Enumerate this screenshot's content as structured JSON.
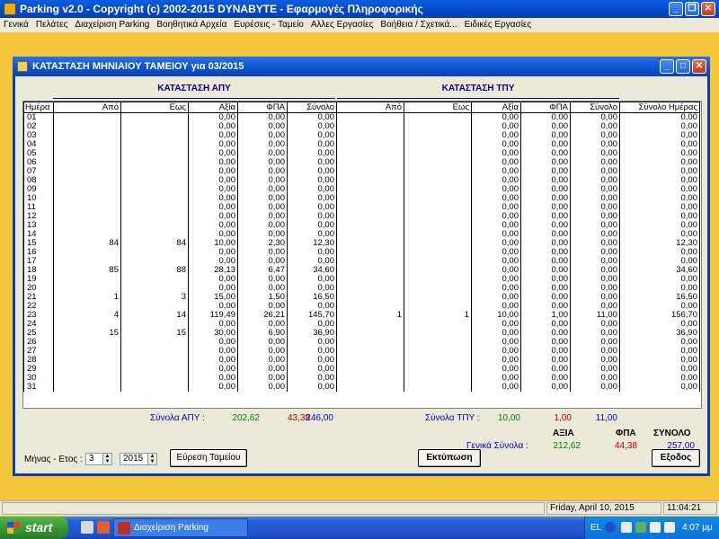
{
  "app": {
    "title": "Parking v2.0  -  Copyright (c) 2002-2015  DYNABYTE - Εφαρμογές Πληροφορικής"
  },
  "menu": [
    "Γενικά",
    "Πελάτες",
    "Διαχείριση Parking",
    "Βοηθητικά Αρχεία",
    "Ευρέσεις - Ταμείο",
    "Αλλες Εργασίες",
    "Βοήθεια / Σχετικά...",
    "Ειδικές Εργασίες"
  ],
  "dialog": {
    "title": "ΚΑΤΑΣΤΑΣΗ ΜΗΝΙΑΙΟΥ ΤΑΜΕΙΟΥ για  03/2015",
    "section_apy": "ΚΑΤΑΣΤΑΣΗ ΑΠΥ",
    "section_tpy": "ΚΑΤΑΣΤΑΣΗ ΤΠΥ",
    "columns": [
      "Ημέρα",
      "Από",
      "Εως",
      "Αξία",
      "ΦΠΑ",
      "Σύνολο",
      "Από",
      "Εως",
      "Αξία",
      "ΦΠΑ",
      "Σύνολο",
      "Σύνολο Ημέρας"
    ],
    "rows": [
      [
        "01",
        "",
        "",
        "0,00",
        "0,00",
        "0,00",
        "",
        "",
        "0,00",
        "0,00",
        "0,00",
        "0,00"
      ],
      [
        "02",
        "",
        "",
        "0,00",
        "0,00",
        "0,00",
        "",
        "",
        "0,00",
        "0,00",
        "0,00",
        "0,00"
      ],
      [
        "03",
        "",
        "",
        "0,00",
        "0,00",
        "0,00",
        "",
        "",
        "0,00",
        "0,00",
        "0,00",
        "0,00"
      ],
      [
        "04",
        "",
        "",
        "0,00",
        "0,00",
        "0,00",
        "",
        "",
        "0,00",
        "0,00",
        "0,00",
        "0,00"
      ],
      [
        "05",
        "",
        "",
        "0,00",
        "0,00",
        "0,00",
        "",
        "",
        "0,00",
        "0,00",
        "0,00",
        "0,00"
      ],
      [
        "06",
        "",
        "",
        "0,00",
        "0,00",
        "0,00",
        "",
        "",
        "0,00",
        "0,00",
        "0,00",
        "0,00"
      ],
      [
        "07",
        "",
        "",
        "0,00",
        "0,00",
        "0,00",
        "",
        "",
        "0,00",
        "0,00",
        "0,00",
        "0,00"
      ],
      [
        "08",
        "",
        "",
        "0,00",
        "0,00",
        "0,00",
        "",
        "",
        "0,00",
        "0,00",
        "0,00",
        "0,00"
      ],
      [
        "09",
        "",
        "",
        "0,00",
        "0,00",
        "0,00",
        "",
        "",
        "0,00",
        "0,00",
        "0,00",
        "0,00"
      ],
      [
        "10",
        "",
        "",
        "0,00",
        "0,00",
        "0,00",
        "",
        "",
        "0,00",
        "0,00",
        "0,00",
        "0,00"
      ],
      [
        "11",
        "",
        "",
        "0,00",
        "0,00",
        "0,00",
        "",
        "",
        "0,00",
        "0,00",
        "0,00",
        "0,00"
      ],
      [
        "12",
        "",
        "",
        "0,00",
        "0,00",
        "0,00",
        "",
        "",
        "0,00",
        "0,00",
        "0,00",
        "0,00"
      ],
      [
        "13",
        "",
        "",
        "0,00",
        "0,00",
        "0,00",
        "",
        "",
        "0,00",
        "0,00",
        "0,00",
        "0,00"
      ],
      [
        "14",
        "",
        "",
        "0,00",
        "0,00",
        "0,00",
        "",
        "",
        "0,00",
        "0,00",
        "0,00",
        "0,00"
      ],
      [
        "15",
        "84",
        "84",
        "10,00",
        "2,30",
        "12,30",
        "",
        "",
        "0,00",
        "0,00",
        "0,00",
        "12,30"
      ],
      [
        "16",
        "",
        "",
        "0,00",
        "0,00",
        "0,00",
        "",
        "",
        "0,00",
        "0,00",
        "0,00",
        "0,00"
      ],
      [
        "17",
        "",
        "",
        "0,00",
        "0,00",
        "0,00",
        "",
        "",
        "0,00",
        "0,00",
        "0,00",
        "0,00"
      ],
      [
        "18",
        "85",
        "88",
        "28,13",
        "6,47",
        "34,60",
        "",
        "",
        "0,00",
        "0,00",
        "0,00",
        "34,60"
      ],
      [
        "19",
        "",
        "",
        "0,00",
        "0,00",
        "0,00",
        "",
        "",
        "0,00",
        "0,00",
        "0,00",
        "0,00"
      ],
      [
        "20",
        "",
        "",
        "0,00",
        "0,00",
        "0,00",
        "",
        "",
        "0,00",
        "0,00",
        "0,00",
        "0,00"
      ],
      [
        "21",
        "1",
        "3",
        "15,00",
        "1,50",
        "16,50",
        "",
        "",
        "0,00",
        "0,00",
        "0,00",
        "16,50"
      ],
      [
        "22",
        "",
        "",
        "0,00",
        "0,00",
        "0,00",
        "",
        "",
        "0,00",
        "0,00",
        "0,00",
        "0,00"
      ],
      [
        "23",
        "4",
        "14",
        "119,49",
        "26,21",
        "145,70",
        "1",
        "1",
        "10,00",
        "1,00",
        "11,00",
        "156,70"
      ],
      [
        "24",
        "",
        "",
        "0,00",
        "0,00",
        "0,00",
        "",
        "",
        "0,00",
        "0,00",
        "0,00",
        "0,00"
      ],
      [
        "25",
        "15",
        "15",
        "30,00",
        "6,90",
        "36,90",
        "",
        "",
        "0,00",
        "0,00",
        "0,00",
        "36,90"
      ],
      [
        "26",
        "",
        "",
        "0,00",
        "0,00",
        "0,00",
        "",
        "",
        "0,00",
        "0,00",
        "0,00",
        "0,00"
      ],
      [
        "27",
        "",
        "",
        "0,00",
        "0,00",
        "0,00",
        "",
        "",
        "0,00",
        "0,00",
        "0,00",
        "0,00"
      ],
      [
        "28",
        "",
        "",
        "0,00",
        "0,00",
        "0,00",
        "",
        "",
        "0,00",
        "0,00",
        "0,00",
        "0,00"
      ],
      [
        "29",
        "",
        "",
        "0,00",
        "0,00",
        "0,00",
        "",
        "",
        "0,00",
        "0,00",
        "0,00",
        "0,00"
      ],
      [
        "30",
        "",
        "",
        "0,00",
        "0,00",
        "0,00",
        "",
        "",
        "0,00",
        "0,00",
        "0,00",
        "0,00"
      ],
      [
        "31",
        "",
        "",
        "0,00",
        "0,00",
        "0,00",
        "",
        "",
        "0,00",
        "0,00",
        "0,00",
        "0,00"
      ]
    ],
    "totals_apy": {
      "label": "Σύνολα ΑΠΥ :",
      "value": "202,62",
      "vat": "43,38",
      "total": "246,00"
    },
    "totals_tpy": {
      "label": "Σύνολα ΤΠΥ :",
      "value": "10,00",
      "vat": "1,00",
      "total": "11,00"
    },
    "grand": {
      "label": "Γενικά Σύνολα :",
      "h_value": "ΑΞΙΑ",
      "h_vat": "ΦΠΑ",
      "h_total": "ΣΥΝΟΛΟ",
      "value": "212,62",
      "vat": "44,38",
      "total": "257,00"
    },
    "month_year_label": "Μήνας - Ετος :",
    "month": "3",
    "year": "2015",
    "find_button": "Εύρεση Ταμείου",
    "print_button": "Εκτύπωση",
    "exit_button": "Εξοδος"
  },
  "statusbar": {
    "date": "Friday, April 10, 2015",
    "time": "11:04:21"
  },
  "taskbar": {
    "start": "start",
    "task": "Διαχείριση Parking",
    "lang": "EL",
    "clock": "4:07 μμ"
  },
  "colors": {
    "desktop": "#F5C53C",
    "green": "#008000",
    "red": "#C00000",
    "blue": "#0000C0"
  }
}
